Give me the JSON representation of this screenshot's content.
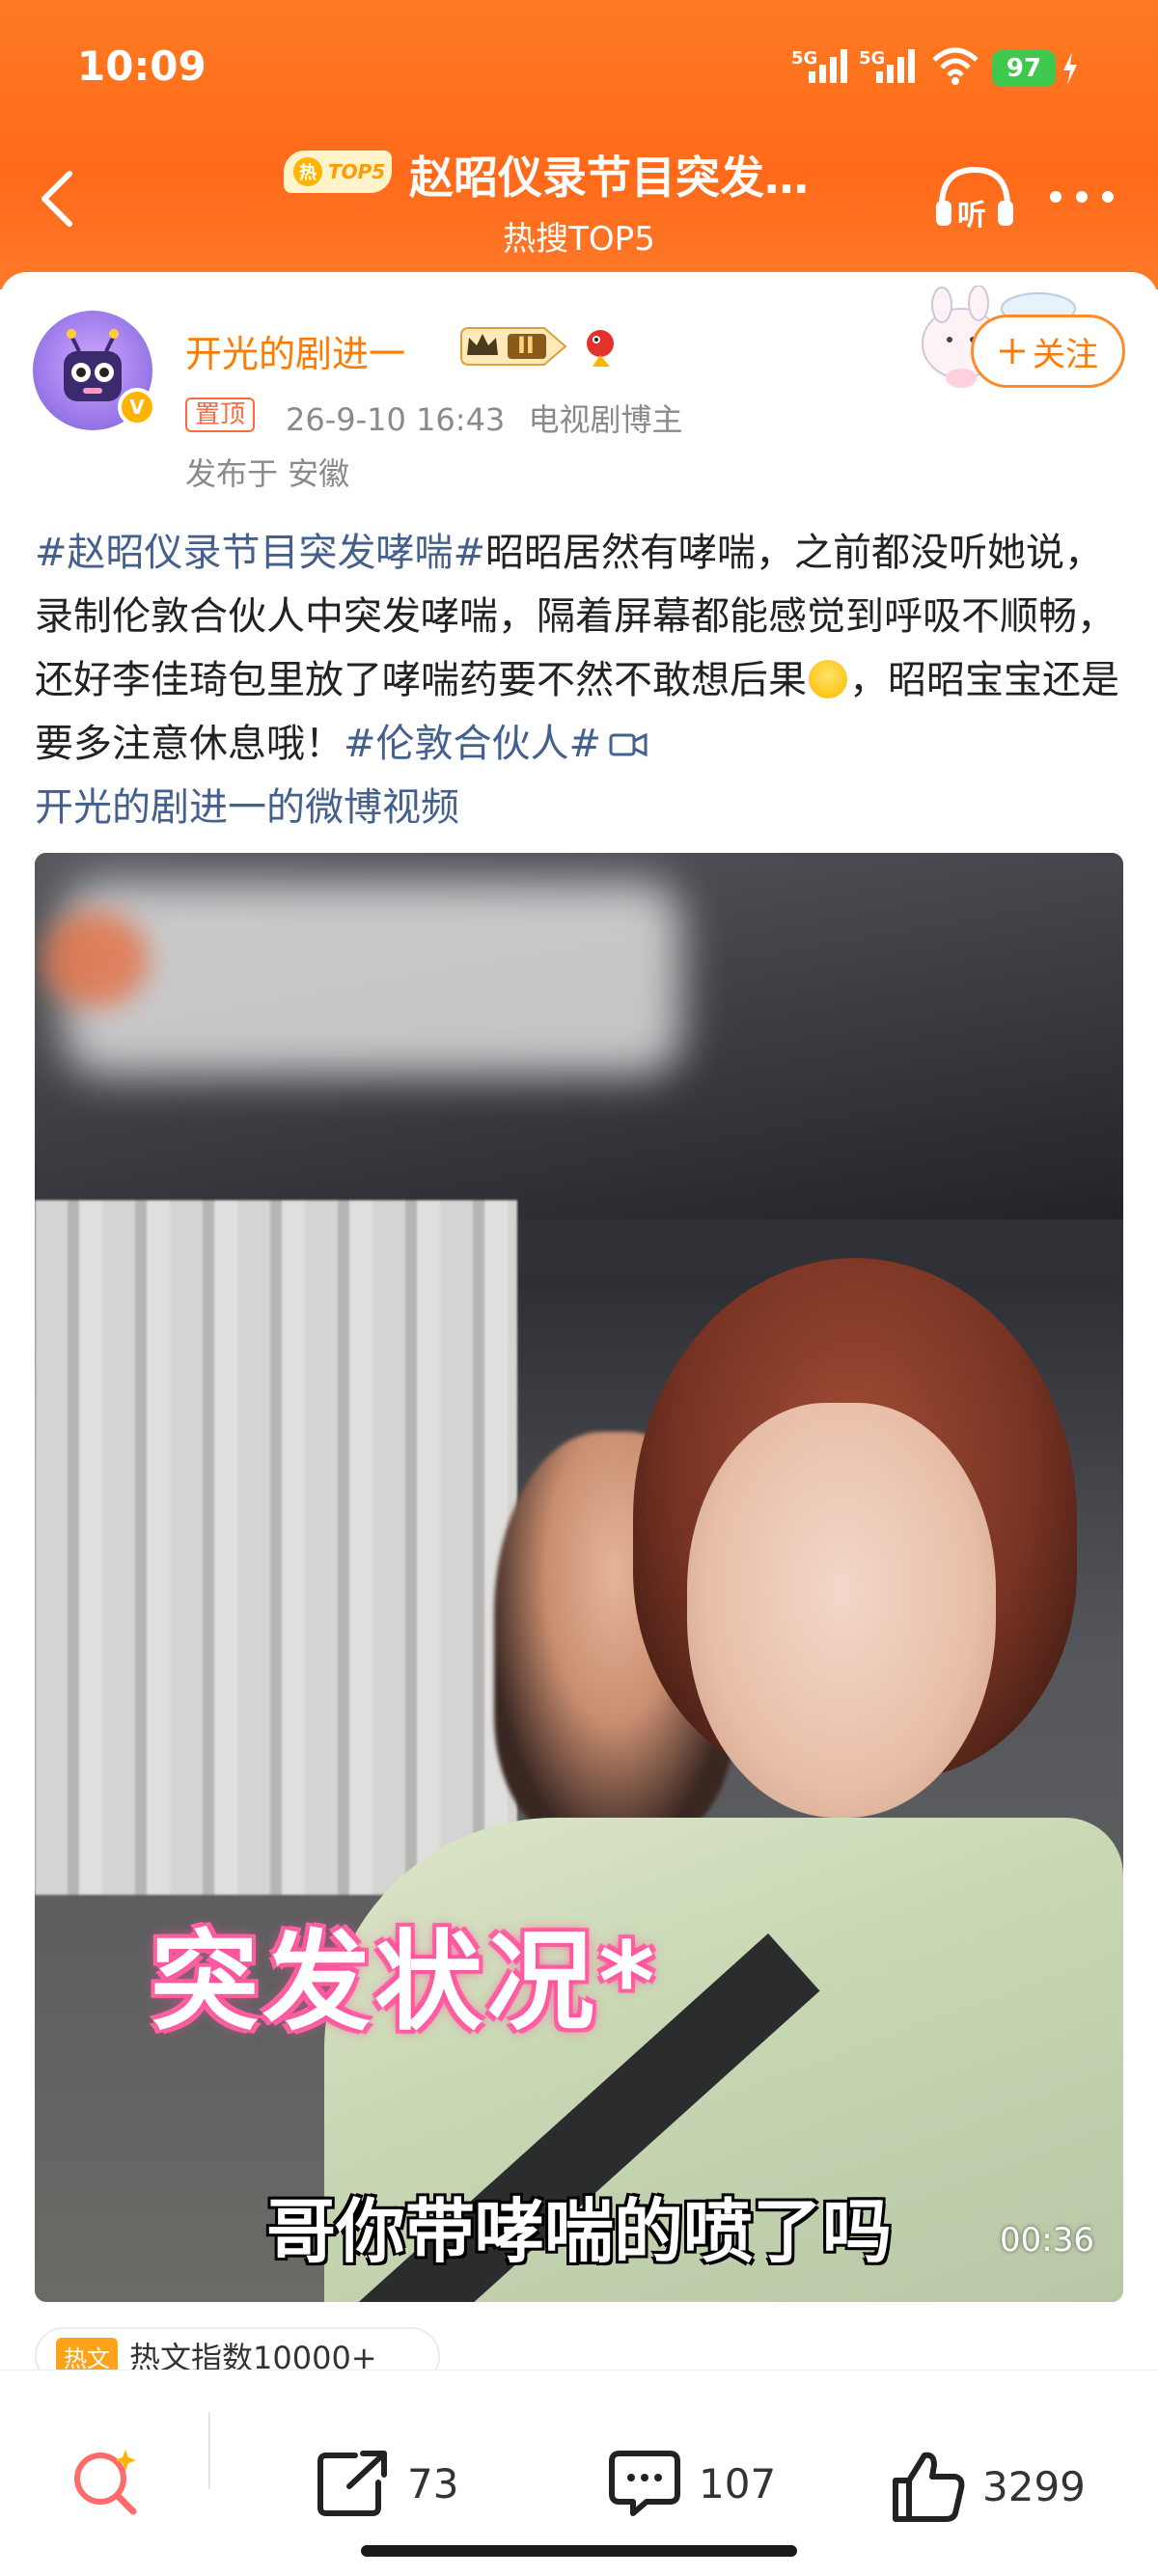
{
  "status_bar": {
    "time": "10:09",
    "net1": "5G",
    "net2": "5G",
    "battery": "97"
  },
  "nav": {
    "hot_badge_char": "热",
    "hot_badge_text": "TOP5",
    "title": "赵昭仪录节目突发…",
    "subtitle": "热搜TOP5",
    "listen_label": "听"
  },
  "author": {
    "name": "开光的剧进一",
    "level": "II",
    "verified_mark": "V",
    "pin_label": "置顶",
    "date": "26-9-10 16:43",
    "role": "电视剧博主",
    "location": "发布于 安徽",
    "follow_label": "关注"
  },
  "post": {
    "hashtag1": "#赵昭仪录节目突发哮喘#",
    "text1": "昭昭居然有哮喘，之前都没听她说，录制伦敦合伙人中突发哮喘，隔着屏幕都能感觉到呼吸不顺畅，还好李佳琦包里放了哮喘药要不然不敢想后果",
    "text2": "，昭昭宝宝还是要多注意休息哦！",
    "hashtag2": "#伦敦合伙人#",
    "video_link": "开光的剧进一的微博视频"
  },
  "video": {
    "overlay_caption": "突发状况*",
    "subtitle": "哥你带哮喘的喷了吗",
    "duration": "00:36"
  },
  "hot_index": {
    "badge": "热文",
    "text": "热文指数10000+"
  },
  "actions": {
    "repost_count": "73",
    "comment_count": "107",
    "like_count": "3299"
  },
  "colors": {
    "header_orange": "#ff6a1a",
    "username_orange": "#ff7a00",
    "hashtag_blue": "#44608f",
    "pink_caption": "#ff4f9a"
  }
}
